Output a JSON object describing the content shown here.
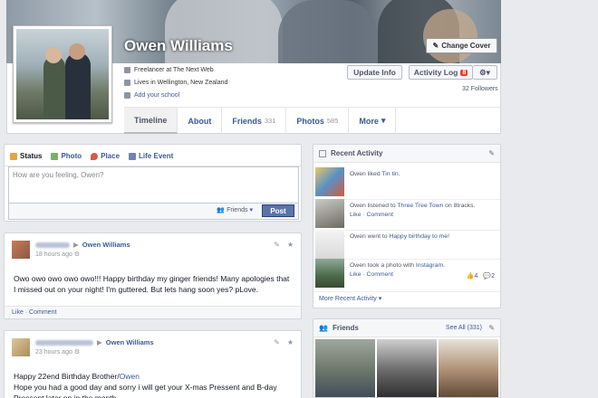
{
  "profile": {
    "name": "Owen Williams",
    "change_cover": "Change Cover",
    "update_info": "Update Info",
    "activity_log": "Activity Log",
    "activity_badge": "8",
    "followers": "32 Followers",
    "info": [
      "Freelancer at The Next Web",
      "Lives in Wellington, New Zealand",
      "Add your school"
    ],
    "tabs": [
      {
        "label": "Timeline",
        "count": ""
      },
      {
        "label": "About",
        "count": ""
      },
      {
        "label": "Friends",
        "count": "331"
      },
      {
        "label": "Photos",
        "count": "585"
      },
      {
        "label": "More",
        "count": ""
      }
    ]
  },
  "composer": {
    "tabs": [
      "Status",
      "Photo",
      "Place",
      "Life Event"
    ],
    "placeholder": "How are you feeling, Owen?",
    "audience": "Friends",
    "post": "Post"
  },
  "posts": [
    {
      "author": "Owen Williams",
      "time": "18 hours ago",
      "body": "Owo owo owo owo owo!!! Happy birthday my ginger friends! Many apologies that I missed out on your night! I'm guttered. But lets hang soon yes? pLove.",
      "footer": "Like · Comment"
    },
    {
      "author": "Owen Williams",
      "time": "23 hours ago",
      "body_line1": "Happy 22end Birthday Brother/",
      "body_line1_link": "Owen",
      "body_line2": "Hope you had a good day and sorry i will get your X-mas Pressent and B-day Pressent later on in the month"
    }
  ],
  "recent_activity": {
    "title": "Recent Activity",
    "items": [
      {
        "pre": "Owen liked ",
        "link": "Tin tin",
        "post": ".",
        "sub": ""
      },
      {
        "pre": "Owen listened to ",
        "link": "Three Tree Town",
        "post": " on 8tracks.",
        "sub": "Like · Comment"
      },
      {
        "pre": "Owen went to ",
        "link": "Happy birthday to me",
        "post": "!",
        "sub": ""
      },
      {
        "pre": "Owen took a photo with ",
        "link": "Instagram",
        "post": ".",
        "sub": "Like · Comment"
      }
    ],
    "likes": "4",
    "comments": "2",
    "more": "More Recent Activity"
  },
  "friends": {
    "title": "Friends",
    "see_all": "See All (331)"
  }
}
